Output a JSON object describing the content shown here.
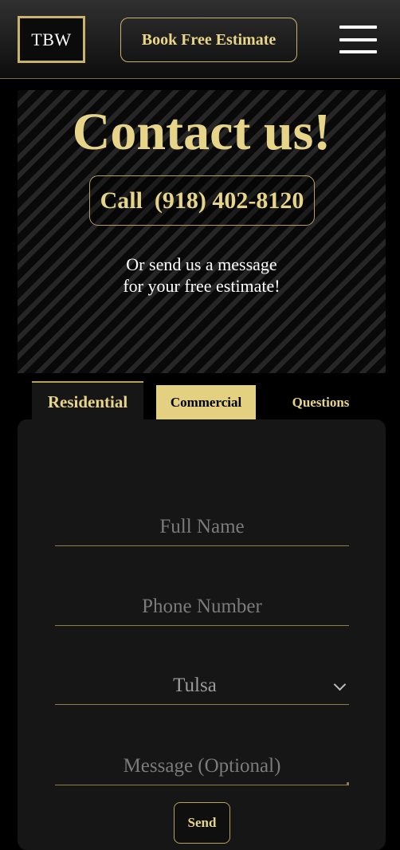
{
  "header": {
    "logo_text": "TBW",
    "book_button": "Book Free Estimate",
    "menu_icon": "hamburger-menu-icon"
  },
  "hero": {
    "title": "Contact us!",
    "call_button": "Call  (918) 402-8120",
    "subtitle_line1": "Or send us a message",
    "subtitle_line2": "for your free estimate!"
  },
  "tabs": [
    {
      "label": "Residential",
      "active": true
    },
    {
      "label": "Commercial",
      "active": false
    },
    {
      "label": "Questions",
      "active": false
    }
  ],
  "form": {
    "full_name_placeholder": "Full Name",
    "phone_placeholder": "Phone Number",
    "city_selected": "Tulsa",
    "message_placeholder": "Message (Optional)",
    "send_button": "Send"
  },
  "colors": {
    "accent_gold": "#e6d489",
    "background": "#000000",
    "panel": "#161616"
  }
}
